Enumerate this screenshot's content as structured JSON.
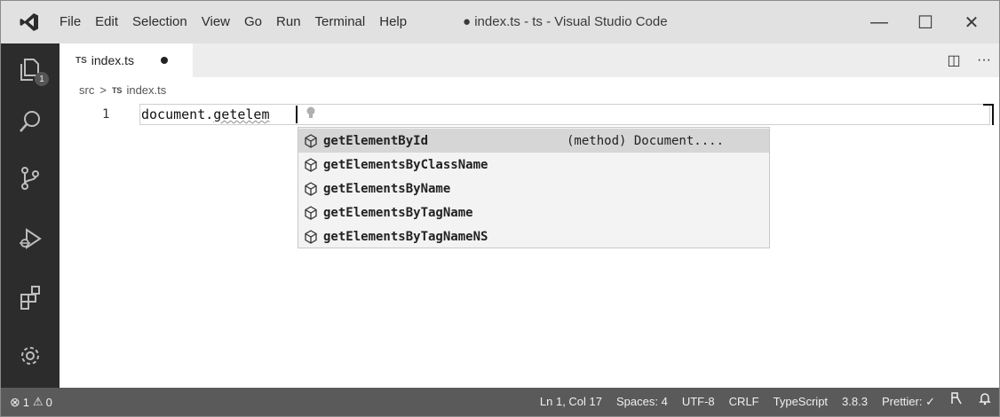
{
  "titlebar": {
    "menu": [
      "File",
      "Edit",
      "Selection",
      "View",
      "Go",
      "Run",
      "Terminal",
      "Help"
    ],
    "title": "● index.ts - ts - Visual Studio Code",
    "minimize": "—",
    "maximize": "☐",
    "close": "✕"
  },
  "activity": {
    "explorer_badge": "1"
  },
  "tab": {
    "lang": "TS",
    "name": "index.ts"
  },
  "tab_actions": {
    "split": "◫",
    "more": "···"
  },
  "breadcrumb": {
    "folder": "src",
    "sep": ">",
    "lang": "TS",
    "file": "index.ts"
  },
  "editor": {
    "line_number": "1",
    "code_prefix": "document.",
    "code_typed": "getelem"
  },
  "suggest": {
    "items": [
      {
        "label": "getElementById",
        "detail": "(method) Document...."
      },
      {
        "label": "getElementsByClassName",
        "detail": ""
      },
      {
        "label": "getElementsByName",
        "detail": ""
      },
      {
        "label": "getElementsByTagName",
        "detail": ""
      },
      {
        "label": "getElementsByTagNameNS",
        "detail": ""
      }
    ]
  },
  "status": {
    "errors": "1",
    "warnings": "0",
    "position": "Ln 1, Col 17",
    "spaces": "Spaces: 4",
    "encoding": "UTF-8",
    "eol": "CRLF",
    "language": "TypeScript",
    "ts_version": "3.8.3",
    "formatter": "Prettier: ✓"
  },
  "colors": {
    "activity_bg": "#2c2c2c",
    "status_bg": "#5a5a5a",
    "title_bg": "#e1e1e1",
    "suggest_sel": "#d6d6d6"
  }
}
